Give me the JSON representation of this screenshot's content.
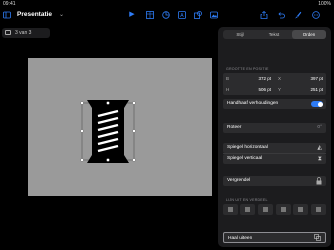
{
  "status": {
    "time": "09:41",
    "battery": "100%"
  },
  "toolbar": {
    "title": "Presentatie",
    "icons": [
      "sidebar-icon",
      "play-icon",
      "table-icon",
      "chart-icon",
      "textbox-icon",
      "shape-icon",
      "media-icon",
      "share-icon",
      "undo-icon",
      "format-brush-icon",
      "more-icon"
    ]
  },
  "slidenav": {
    "label": "3 van 3"
  },
  "panel": {
    "tabs": [
      "Stijl",
      "Tekst",
      "Orden"
    ],
    "active_tab": "Orden",
    "size_heading": "GROOTTE EN POSITIE",
    "fields": [
      {
        "label": "B",
        "value": "372 pt"
      },
      {
        "label": "X",
        "value": "397 pt"
      },
      {
        "label": "H",
        "value": "506 pt"
      },
      {
        "label": "Y",
        "value": "251 pt"
      }
    ],
    "keep_ratio": "Handhaaf verhoudingen",
    "rotate": "Roteer",
    "rotate_value": "0°",
    "flip_h": "Spiegel horizontaal",
    "flip_v": "Spiegel verticaal",
    "lock": "Vergrendel",
    "align_heading": "LIJN UIT EN VERDEEL",
    "ungroup": "Haal uiteen"
  }
}
